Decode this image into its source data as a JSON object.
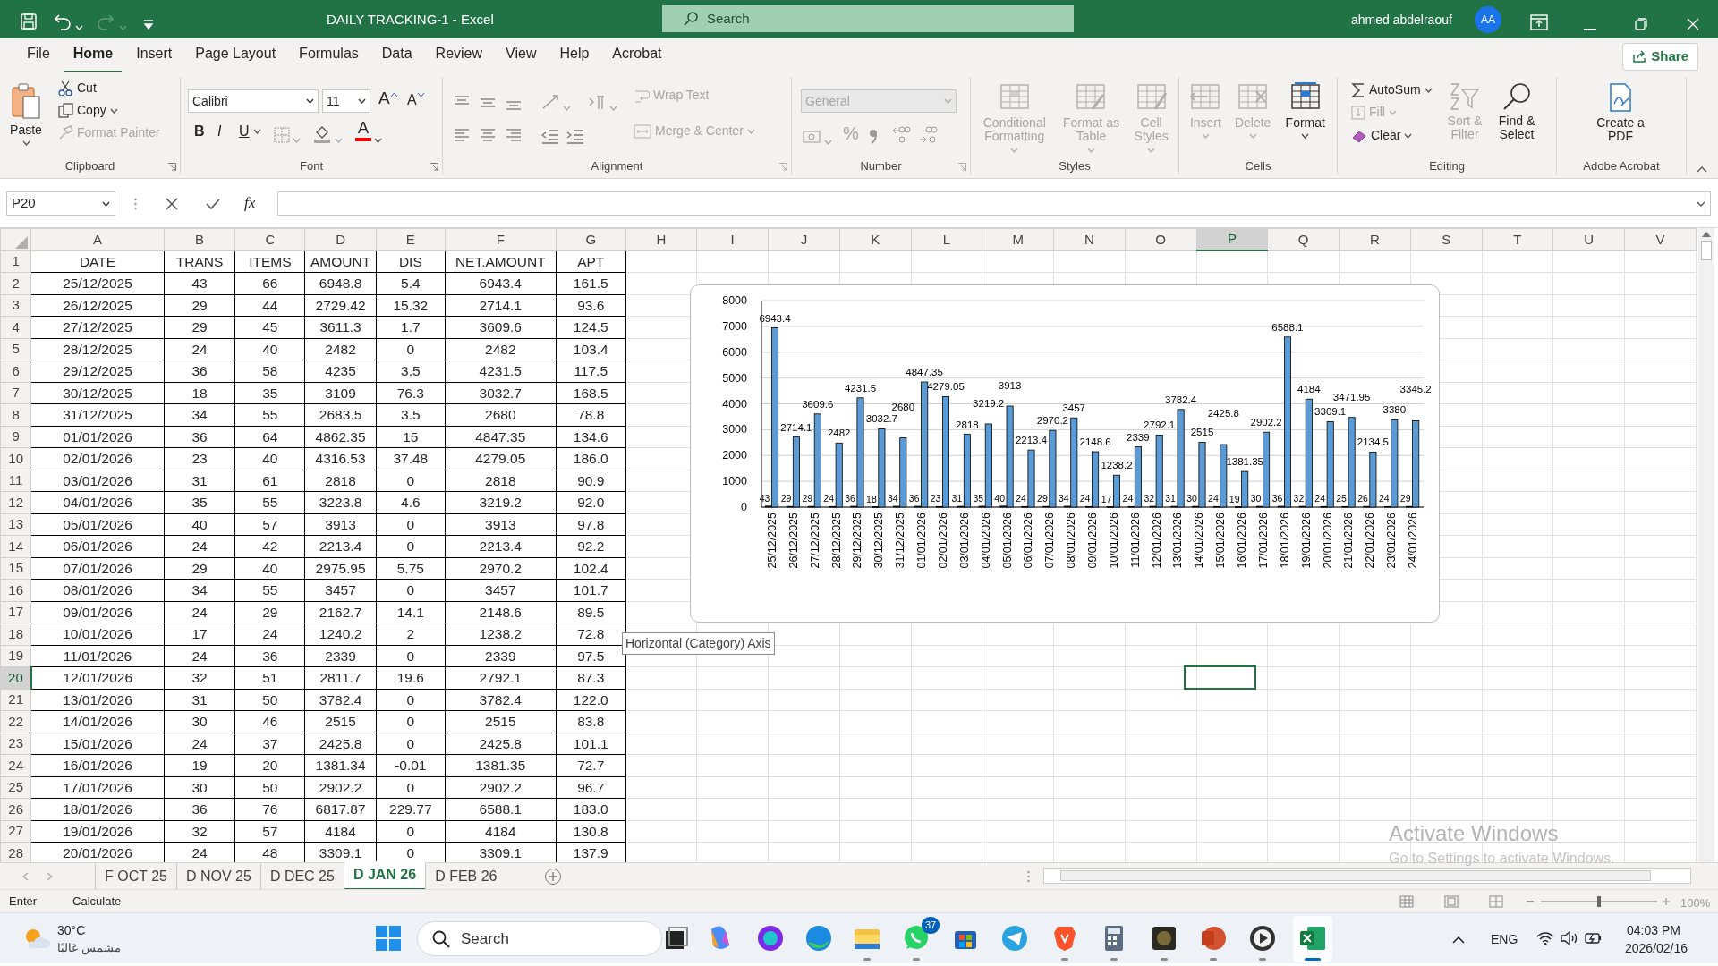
{
  "window": {
    "title": "DAILY TRACKING-1  -  Excel",
    "search_placeholder": "Search",
    "user": "ahmed abdelraouf",
    "avatar": "AA",
    "redo_disabled": true
  },
  "menu_tabs": [
    {
      "label": "File",
      "selected": false
    },
    {
      "label": "Home",
      "selected": true
    },
    {
      "label": "Insert",
      "selected": false
    },
    {
      "label": "Page Layout",
      "selected": false
    },
    {
      "label": "Formulas",
      "selected": false
    },
    {
      "label": "Data",
      "selected": false
    },
    {
      "label": "Review",
      "selected": false
    },
    {
      "label": "View",
      "selected": false
    },
    {
      "label": "Help",
      "selected": false
    },
    {
      "label": "Acrobat",
      "selected": false
    }
  ],
  "share": "Share",
  "ribbon": {
    "clipboard": {
      "name": "Clipboard",
      "items": [
        {
          "label": "Paste",
          "disabled": false
        },
        {
          "label": "Cut",
          "disabled": false
        },
        {
          "label": "Copy",
          "disabled": false
        },
        {
          "label": "Format Painter",
          "disabled": true
        }
      ]
    },
    "font": {
      "name": "Font",
      "font_name": "Calibri",
      "font_size": "11",
      "grow": "A",
      "shrink": "A",
      "bold": "B",
      "italic": "I",
      "underline": "U",
      "font_color": "A"
    },
    "alignment": {
      "name": "Alignment",
      "wrap_text": {
        "label": "Wrap Text",
        "disabled": true
      },
      "merge": {
        "label": "Merge & Center",
        "disabled": true
      }
    },
    "number": {
      "name": "Number",
      "format": "General",
      "format_disabled": true,
      "percent": "%"
    },
    "styles": {
      "name": "Styles",
      "items": [
        {
          "label": "Conditional Formatting",
          "disabled": true
        },
        {
          "label": "Format as Table",
          "disabled": true
        },
        {
          "label": "Cell Styles",
          "disabled": true
        }
      ]
    },
    "cells": {
      "name": "Cells",
      "items": [
        {
          "label": "Insert",
          "disabled": true
        },
        {
          "label": "Delete",
          "disabled": true
        },
        {
          "label": "Format",
          "disabled": false
        }
      ]
    },
    "editing": {
      "name": "Editing",
      "items": [
        {
          "label": "AutoSum",
          "disabled": false
        },
        {
          "label": "Fill",
          "disabled": true
        },
        {
          "label": "Clear",
          "disabled": false
        },
        {
          "label": "Sort & Filter",
          "disabled": true
        },
        {
          "label": "Find & Select",
          "disabled": false
        }
      ]
    },
    "acrobat": {
      "name": "Adobe Acrobat",
      "items": [
        {
          "label": "Create a PDF",
          "disabled": false
        }
      ]
    }
  },
  "formula_bar": {
    "name_box": "P20",
    "fx": "fx"
  },
  "sheet": {
    "columns": [
      {
        "label": "A",
        "selected": false
      },
      {
        "label": "B",
        "selected": false
      },
      {
        "label": "C",
        "selected": false
      },
      {
        "label": "D",
        "selected": false
      },
      {
        "label": "E",
        "selected": false
      },
      {
        "label": "F",
        "selected": false
      },
      {
        "label": "G",
        "selected": false
      },
      {
        "label": "H",
        "selected": false
      },
      {
        "label": "I",
        "selected": false
      },
      {
        "label": "J",
        "selected": false
      },
      {
        "label": "K",
        "selected": false
      },
      {
        "label": "L",
        "selected": false
      },
      {
        "label": "M",
        "selected": false
      },
      {
        "label": "N",
        "selected": false
      },
      {
        "label": "O",
        "selected": false
      },
      {
        "label": "P",
        "selected": true
      },
      {
        "label": "Q",
        "selected": false
      },
      {
        "label": "R",
        "selected": false
      },
      {
        "label": "S",
        "selected": false
      },
      {
        "label": "T",
        "selected": false
      },
      {
        "label": "U",
        "selected": false
      },
      {
        "label": "V",
        "selected": false
      }
    ],
    "rows": [
      {
        "label": "1",
        "selected": false,
        "cells": [
          "DATE",
          "TRANS",
          "ITEMS",
          "AMOUNT",
          "DIS",
          "NET.AMOUNT",
          "APT"
        ]
      },
      {
        "label": "2",
        "selected": false,
        "cells": [
          "25/12/2025",
          "43",
          "66",
          "6948.8",
          "5.4",
          "6943.4",
          "161.5"
        ]
      },
      {
        "label": "3",
        "selected": false,
        "cells": [
          "26/12/2025",
          "29",
          "44",
          "2729.42",
          "15.32",
          "2714.1",
          "93.6"
        ]
      },
      {
        "label": "4",
        "selected": false,
        "cells": [
          "27/12/2025",
          "29",
          "45",
          "3611.3",
          "1.7",
          "3609.6",
          "124.5"
        ]
      },
      {
        "label": "5",
        "selected": false,
        "cells": [
          "28/12/2025",
          "24",
          "40",
          "2482",
          "0",
          "2482",
          "103.4"
        ]
      },
      {
        "label": "6",
        "selected": false,
        "cells": [
          "29/12/2025",
          "36",
          "58",
          "4235",
          "3.5",
          "4231.5",
          "117.5"
        ]
      },
      {
        "label": "7",
        "selected": false,
        "cells": [
          "30/12/2025",
          "18",
          "35",
          "3109",
          "76.3",
          "3032.7",
          "168.5"
        ]
      },
      {
        "label": "8",
        "selected": false,
        "cells": [
          "31/12/2025",
          "34",
          "55",
          "2683.5",
          "3.5",
          "2680",
          "78.8"
        ]
      },
      {
        "label": "9",
        "selected": false,
        "cells": [
          "01/01/2026",
          "36",
          "64",
          "4862.35",
          "15",
          "4847.35",
          "134.6"
        ]
      },
      {
        "label": "10",
        "selected": false,
        "cells": [
          "02/01/2026",
          "23",
          "40",
          "4316.53",
          "37.48",
          "4279.05",
          "186.0"
        ]
      },
      {
        "label": "11",
        "selected": false,
        "cells": [
          "03/01/2026",
          "31",
          "61",
          "2818",
          "0",
          "2818",
          "90.9"
        ]
      },
      {
        "label": "12",
        "selected": false,
        "cells": [
          "04/01/2026",
          "35",
          "55",
          "3223.8",
          "4.6",
          "3219.2",
          "92.0"
        ]
      },
      {
        "label": "13",
        "selected": false,
        "cells": [
          "05/01/2026",
          "40",
          "57",
          "3913",
          "0",
          "3913",
          "97.8"
        ]
      },
      {
        "label": "14",
        "selected": false,
        "cells": [
          "06/01/2026",
          "24",
          "42",
          "2213.4",
          "0",
          "2213.4",
          "92.2"
        ]
      },
      {
        "label": "15",
        "selected": false,
        "cells": [
          "07/01/2026",
          "29",
          "40",
          "2975.95",
          "5.75",
          "2970.2",
          "102.4"
        ]
      },
      {
        "label": "16",
        "selected": false,
        "cells": [
          "08/01/2026",
          "34",
          "55",
          "3457",
          "0",
          "3457",
          "101.7"
        ]
      },
      {
        "label": "17",
        "selected": false,
        "cells": [
          "09/01/2026",
          "24",
          "29",
          "2162.7",
          "14.1",
          "2148.6",
          "89.5"
        ]
      },
      {
        "label": "18",
        "selected": false,
        "cells": [
          "10/01/2026",
          "17",
          "24",
          "1240.2",
          "2",
          "1238.2",
          "72.8"
        ]
      },
      {
        "label": "19",
        "selected": false,
        "cells": [
          "11/01/2026",
          "24",
          "36",
          "2339",
          "0",
          "2339",
          "97.5"
        ]
      },
      {
        "label": "20",
        "selected": true,
        "cells": [
          "12/01/2026",
          "32",
          "51",
          "2811.7",
          "19.6",
          "2792.1",
          "87.3"
        ]
      },
      {
        "label": "21",
        "selected": false,
        "cells": [
          "13/01/2026",
          "31",
          "50",
          "3782.4",
          "0",
          "3782.4",
          "122.0"
        ]
      },
      {
        "label": "22",
        "selected": false,
        "cells": [
          "14/01/2026",
          "30",
          "46",
          "2515",
          "0",
          "2515",
          "83.8"
        ]
      },
      {
        "label": "23",
        "selected": false,
        "cells": [
          "15/01/2026",
          "24",
          "37",
          "2425.8",
          "0",
          "2425.8",
          "101.1"
        ]
      },
      {
        "label": "24",
        "selected": false,
        "cells": [
          "16/01/2026",
          "19",
          "20",
          "1381.34",
          "-0.01",
          "1381.35",
          "72.7"
        ]
      },
      {
        "label": "25",
        "selected": false,
        "cells": [
          "17/01/2026",
          "30",
          "50",
          "2902.2",
          "0",
          "2902.2",
          "96.7"
        ]
      },
      {
        "label": "26",
        "selected": false,
        "cells": [
          "18/01/2026",
          "36",
          "76",
          "6817.87",
          "229.77",
          "6588.1",
          "183.0"
        ]
      },
      {
        "label": "27",
        "selected": false,
        "cells": [
          "19/01/2026",
          "32",
          "57",
          "4184",
          "0",
          "4184",
          "130.8"
        ]
      },
      {
        "label": "28",
        "selected": false,
        "cells": [
          "20/01/2026",
          "24",
          "48",
          "3309.1",
          "0",
          "3309.1",
          "137.9"
        ]
      }
    ]
  },
  "chart": {
    "chart_data": {
      "type": "bar",
      "categories": [
        "25/12/2025",
        "26/12/2025",
        "27/12/2025",
        "28/12/2025",
        "29/12/2025",
        "30/12/2025",
        "31/12/2025",
        "01/01/2026",
        "02/01/2026",
        "03/01/2026",
        "04/01/2026",
        "05/01/2026",
        "06/01/2026",
        "07/01/2026",
        "08/01/2026",
        "09/01/2026",
        "10/01/2026",
        "11/01/2026",
        "12/01/2026",
        "13/01/2026",
        "14/01/2026",
        "15/01/2026",
        "16/01/2026",
        "17/01/2026",
        "18/01/2026",
        "19/01/2026",
        "20/01/2026",
        "21/01/2026",
        "22/01/2026",
        "23/01/2026",
        "24/01/2026"
      ],
      "series": [
        {
          "color": "#1f3864",
          "values": [
            43,
            29,
            29,
            24,
            36,
            18,
            34,
            36,
            23,
            31,
            35,
            40,
            24,
            29,
            34,
            24,
            17,
            24,
            32,
            31,
            30,
            24,
            19,
            30,
            36,
            32,
            24,
            25,
            26,
            24,
            29
          ]
        },
        {
          "color": "#5b9bd5",
          "values": [
            6943.4,
            2714.1,
            3609.6,
            2482,
            4231.5,
            3032.7,
            2680,
            4847.35,
            4279.05,
            2818,
            3219.2,
            3913,
            2213.4,
            2970.2,
            3457,
            2148.6,
            1238.2,
            2339,
            2792.1,
            3782.4,
            2515,
            2425.8,
            1381.35,
            2902.2,
            6588.1,
            4184,
            3309.1,
            3471.95,
            2134.5,
            3380,
            3345.2
          ]
        }
      ],
      "ylim": [
        0,
        8000
      ],
      "grid": true,
      "yticks": [
        0,
        1000,
        2000,
        3000,
        4000,
        5000,
        6000,
        7000,
        8000
      ],
      "data_labels": true
    },
    "tooltip": "Horizontal (Category) Axis"
  },
  "sheet_tabs": [
    {
      "label": "F OCT 25",
      "selected": false
    },
    {
      "label": "D NOV 25",
      "selected": false
    },
    {
      "label": "D DEC 25",
      "selected": false
    },
    {
      "label": "D JAN 26",
      "selected": true
    },
    {
      "label": "D FEB 26",
      "selected": false
    }
  ],
  "status_bar": {
    "mode": "Enter",
    "calculate": "Calculate",
    "zoom": {
      "level": 0.5,
      "label": "100%"
    }
  },
  "activation": {
    "title": "Activate Windows",
    "text": "Go to Settings to activate Windows."
  },
  "taskbar": {
    "weather": {
      "temp": "30°C",
      "condition": "مشمس غالبًا"
    },
    "search": "Search",
    "apps": [
      {
        "running": false,
        "selected": false
      },
      {
        "running": false,
        "selected": false
      },
      {
        "running": false,
        "selected": false
      },
      {
        "running": false,
        "selected": false
      },
      {
        "running": true,
        "selected": false
      },
      {
        "running": true,
        "selected": false,
        "badge": "37"
      },
      {
        "running": false,
        "selected": false
      },
      {
        "running": false,
        "selected": false
      },
      {
        "running": true,
        "selected": false
      },
      {
        "running": true,
        "selected": false
      },
      {
        "running": true,
        "selected": false
      },
      {
        "running": true,
        "selected": false
      },
      {
        "running": true,
        "selected": false
      },
      {
        "running": true,
        "selected": true
      }
    ],
    "language": "ENG",
    "time": "04:03 PM",
    "date": "2026/02/16"
  }
}
